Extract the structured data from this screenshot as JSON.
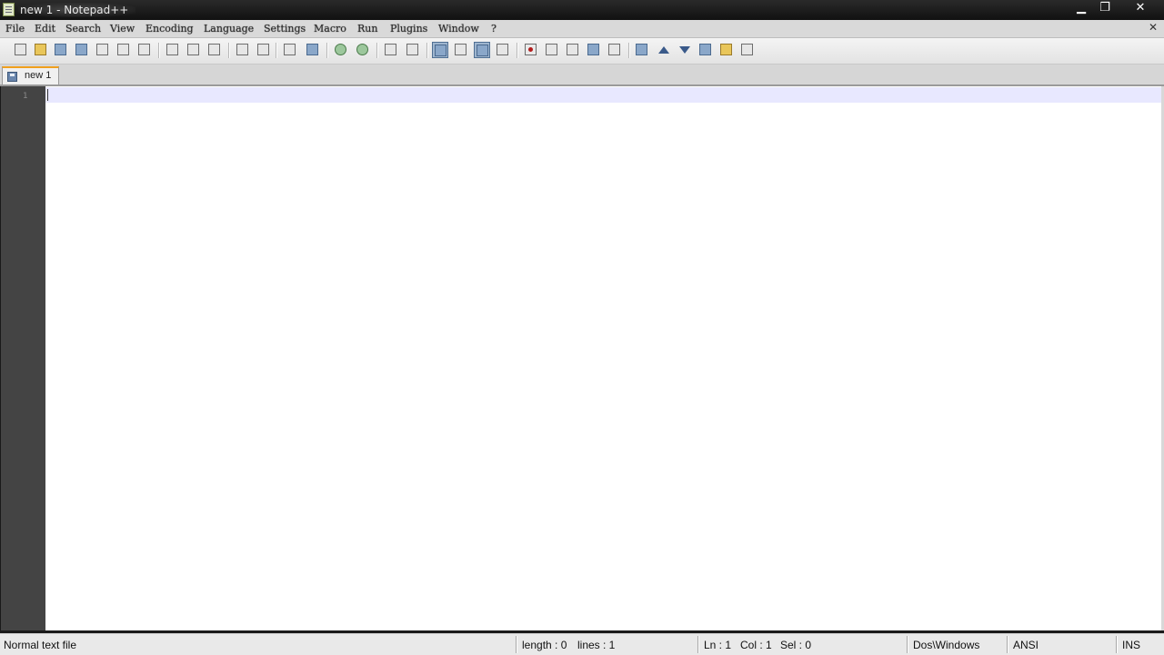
{
  "window": {
    "title": "new  1 - Notepad++",
    "controls": {
      "minimize": "▁",
      "maximize": "❐",
      "close": "✕"
    }
  },
  "menu": {
    "items": [
      "File",
      "Edit",
      "Search",
      "View",
      "Encoding",
      "Language",
      "Settings",
      "Macro",
      "Run",
      "Plugins",
      "Window",
      "?"
    ],
    "close_doc": "✕"
  },
  "toolbar": {
    "buttons": [
      {
        "name": "new-file-icon"
      },
      {
        "name": "open-file-icon"
      },
      {
        "name": "save-icon"
      },
      {
        "name": "save-all-icon"
      },
      {
        "name": "close-icon"
      },
      {
        "name": "close-all-icon"
      },
      {
        "name": "print-icon"
      },
      {
        "name": "cut-icon"
      },
      {
        "name": "copy-icon"
      },
      {
        "name": "paste-icon"
      },
      {
        "name": "undo-icon"
      },
      {
        "name": "redo-icon"
      },
      {
        "name": "find-icon"
      },
      {
        "name": "replace-icon"
      },
      {
        "name": "zoom-in-icon"
      },
      {
        "name": "zoom-out-icon"
      },
      {
        "name": "sync-vertical-icon"
      },
      {
        "name": "sync-horizontal-icon"
      },
      {
        "name": "word-wrap-icon"
      },
      {
        "name": "show-all-chars-icon"
      },
      {
        "name": "indent-guide-icon"
      },
      {
        "name": "user-language-icon"
      },
      {
        "name": "record-macro-icon"
      },
      {
        "name": "stop-record-icon"
      },
      {
        "name": "playback-macro-icon"
      },
      {
        "name": "run-macro-multiple-icon"
      },
      {
        "name": "save-macro-icon"
      },
      {
        "name": "fold-icon"
      },
      {
        "name": "previous-icon"
      },
      {
        "name": "next-icon"
      },
      {
        "name": "unfold-icon"
      },
      {
        "name": "folder-icon"
      },
      {
        "name": "spellcheck-icon"
      }
    ]
  },
  "tabs": [
    {
      "label": "new  1",
      "active": true,
      "icon": "save-icon"
    }
  ],
  "editor": {
    "line_numbers": [
      "1"
    ],
    "content": "",
    "current_line_color": "#e8e8ff",
    "gutter_color": "#444444"
  },
  "status": {
    "file_type": "Normal text file",
    "length": "length : 0",
    "lines": "lines : 1",
    "ln": "Ln : 1",
    "col": "Col : 1",
    "sel": "Sel : 0",
    "eol": "Dos\\Windows",
    "encoding": "ANSI",
    "mode": "INS"
  }
}
